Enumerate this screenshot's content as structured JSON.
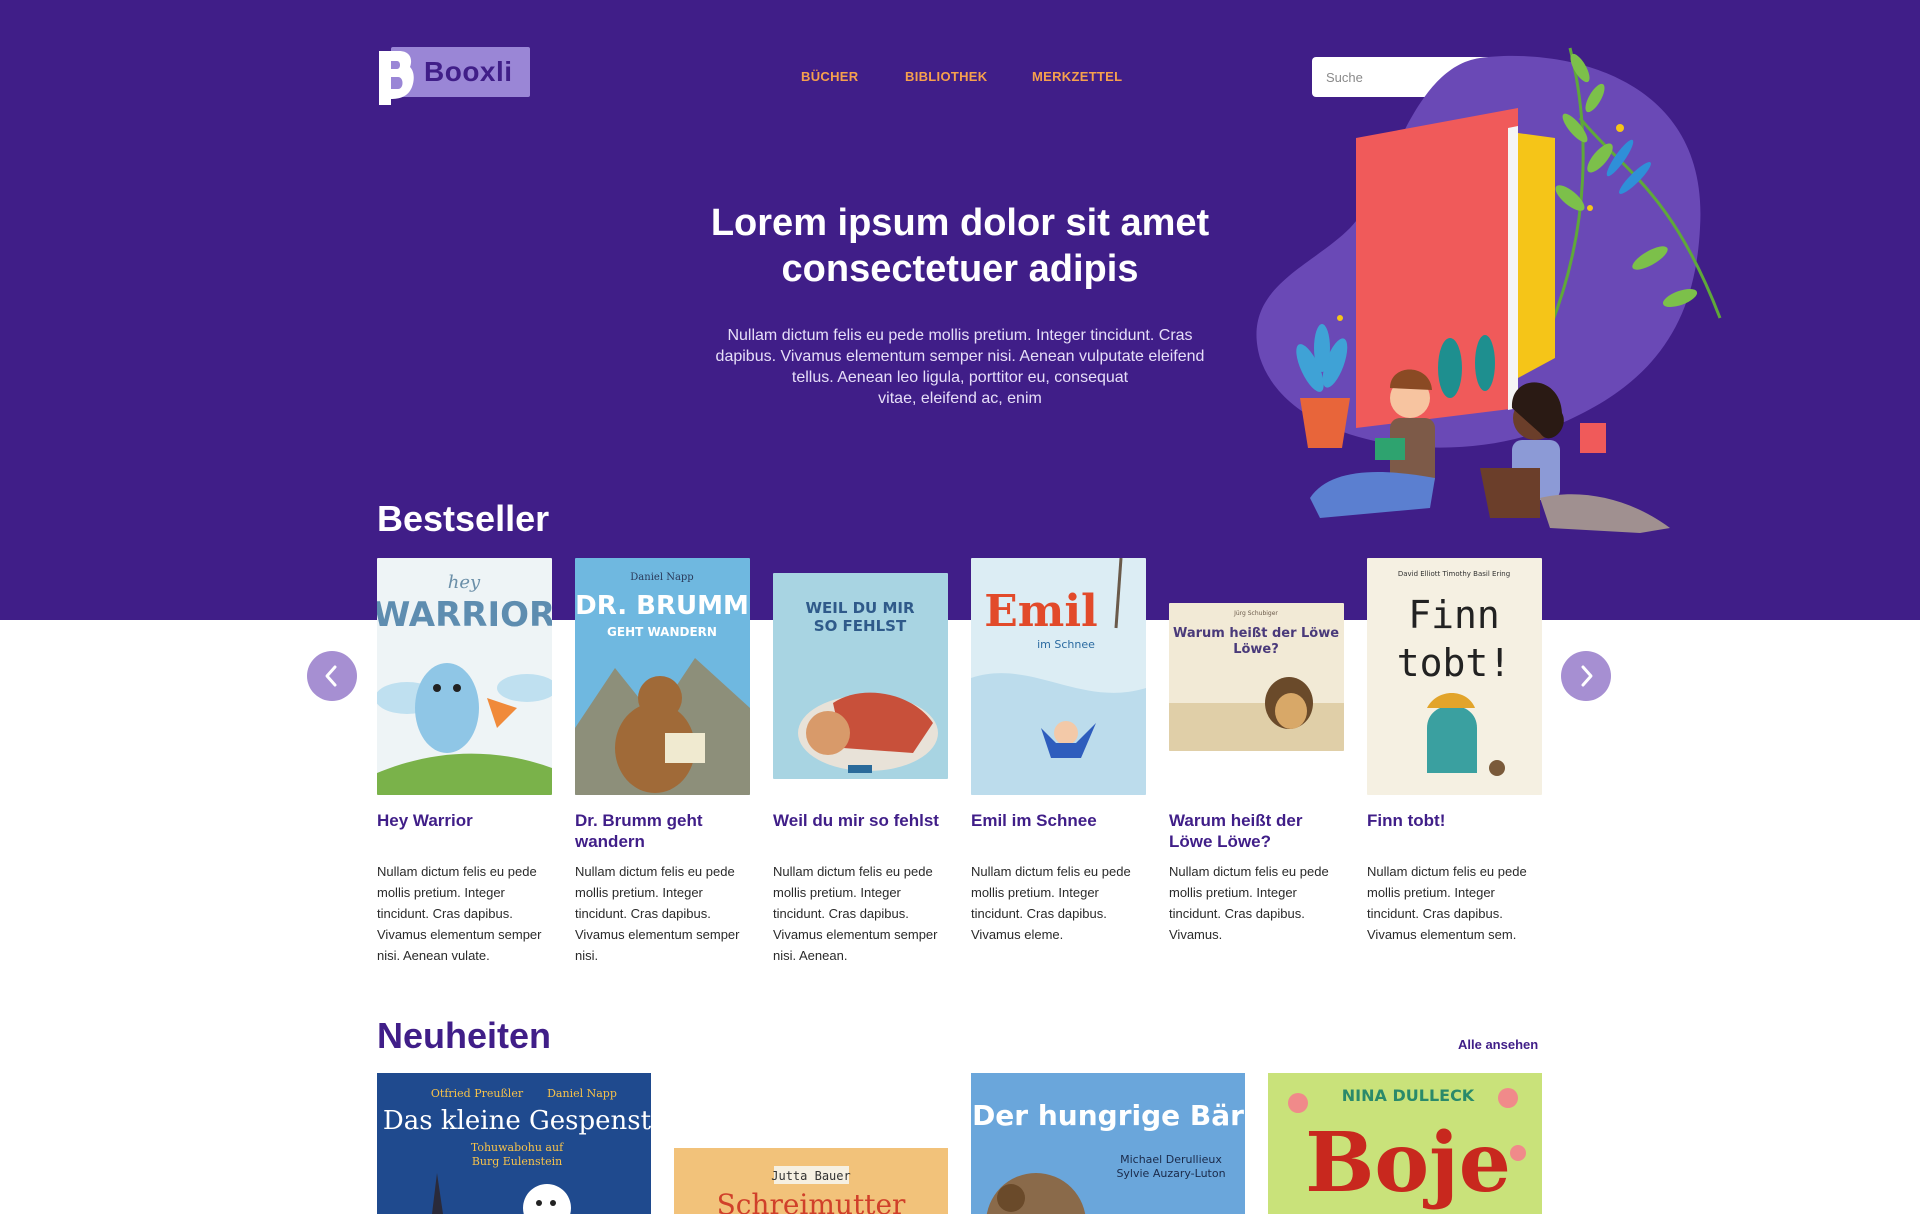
{
  "brand": {
    "name": "Booxli"
  },
  "nav": {
    "items": [
      "BÜCHER",
      "BIBLIOTHEK",
      "MERKZETTEL"
    ]
  },
  "search": {
    "placeholder": "Suche"
  },
  "hero": {
    "headline_line1": "Lorem ipsum dolor sit amet",
    "headline_line2": "consectetuer adipis",
    "sub_line1": "Nullam dictum felis eu pede mollis pretium. Integer tincidunt. Cras",
    "sub_line2": "dapibus. Vivamus elementum semper nisi. Aenean vulputate eleifend",
    "sub_line3": "tellus. Aenean leo ligula, porttitor eu, consequat",
    "sub_line4": "vitae, eleifend ac, enim"
  },
  "bestseller": {
    "title": "Bestseller",
    "books": [
      {
        "title": "Hey Warrior",
        "description": "Nullam dictum felis eu pede mollis pretium. Integer tincidunt. Cras dapibus. Vivamus elementum semper nisi. Aenean vulate.",
        "cover_text": "hey WARRIOR",
        "cover_color": "#e9f1f4"
      },
      {
        "title": "Dr. Brumm geht wandern",
        "description": "Nullam dictum felis eu pede mollis pretium. Integer tincidunt. Cras dapibus. Vivamus elementum semper nisi.",
        "cover_author": "Daniel Napp",
        "cover_text": "DR. BRUMM",
        "cover_sub": "GEHT WANDERN",
        "cover_color": "#6fb8e0"
      },
      {
        "title": "Weil du mir so fehlst",
        "description": "Nullam dictum felis eu pede mollis pretium. Integer tincidunt. Cras dapibus. Vivamus elementum semper nisi. Aenean.",
        "cover_text": "WEIL DU MIR SO FEHLST",
        "cover_color": "#9fcfdf"
      },
      {
        "title": "Emil im Schnee",
        "description": "Nullam dictum felis eu pede mollis pretium. Integer tincidunt. Cras dapibus. Vivamus eleme.",
        "cover_text": "Emil",
        "cover_sub": "im Schnee",
        "cover_color": "#d6ecf4"
      },
      {
        "title": "Warum heißt der Löwe Löwe?",
        "description": "Nullam dictum felis eu pede mollis pretium. Integer tincidunt. Cras dapibus. Vivamus.",
        "cover_author": "Jürg Schubiger",
        "cover_text": "Warum heißt der Löwe Löwe?",
        "cover_color": "#f2ead6"
      },
      {
        "title": "Finn tobt!",
        "description": "Nullam dictum felis eu pede mollis pretium. Integer tincidunt. Cras dapibus. Vivamus elementum sem.",
        "cover_author": "David Elliott   Timothy Basil Ering",
        "cover_text": "Finn tobt!",
        "cover_color": "#f5f0e2"
      }
    ]
  },
  "neuheiten": {
    "title": "Neuheiten",
    "see_all": "Alle ansehen",
    "books": [
      {
        "cover_author": "Otfried Preußler          Daniel Napp",
        "cover_text": "Das kleine Gespenst",
        "cover_sub": "Tohuwabohu auf Burg Eulenstein",
        "cover_color": "#1f4a8e"
      },
      {
        "cover_author": "Jutta Bauer",
        "cover_text": "Schreimutter",
        "cover_color": "#f2c27a"
      },
      {
        "cover_text": "Der hungrige Bär",
        "cover_author": "Michael Derullieux Sylvie Auzary-Luton",
        "cover_color": "#6aa6db"
      },
      {
        "cover_author": "NINA DULLECK",
        "cover_text": "Boje",
        "cover_color": "#c9e27a"
      }
    ]
  }
}
